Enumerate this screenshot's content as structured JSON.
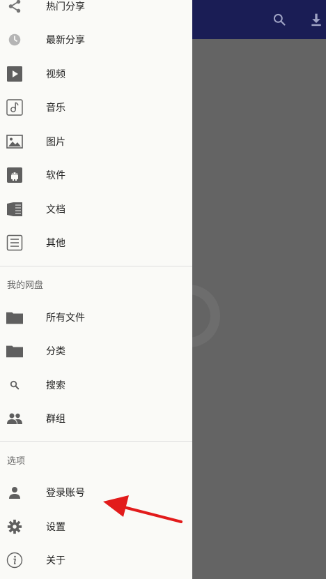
{
  "drawer": {
    "share_items": [
      {
        "label": "热门分享",
        "icon": "share-icon"
      },
      {
        "label": "最新分享",
        "icon": "clock-icon"
      },
      {
        "label": "视频",
        "icon": "video-icon"
      },
      {
        "label": "音乐",
        "icon": "music-icon"
      },
      {
        "label": "图片",
        "icon": "image-icon"
      },
      {
        "label": "软件",
        "icon": "android-icon"
      },
      {
        "label": "文档",
        "icon": "document-icon"
      },
      {
        "label": "其他",
        "icon": "list-icon"
      }
    ],
    "section_my_drive": "我的网盘",
    "drive_items": [
      {
        "label": "所有文件",
        "icon": "folder-icon"
      },
      {
        "label": "分类",
        "icon": "folder-icon"
      },
      {
        "label": "搜索",
        "icon": "search-icon"
      },
      {
        "label": "群组",
        "icon": "group-icon"
      }
    ],
    "section_options": "选项",
    "option_items": [
      {
        "label": "登录账号",
        "icon": "person-icon"
      },
      {
        "label": "设置",
        "icon": "gear-icon"
      },
      {
        "label": "关于",
        "icon": "info-icon"
      }
    ]
  },
  "appbar": {
    "actions": [
      "search-icon",
      "download-icon"
    ]
  },
  "colors": {
    "appbar": "#1a1d55",
    "drawer_bg": "#fafaf7",
    "scrim": "#646464",
    "annotation_arrow": "#e21b1b",
    "icon": "#757575"
  }
}
